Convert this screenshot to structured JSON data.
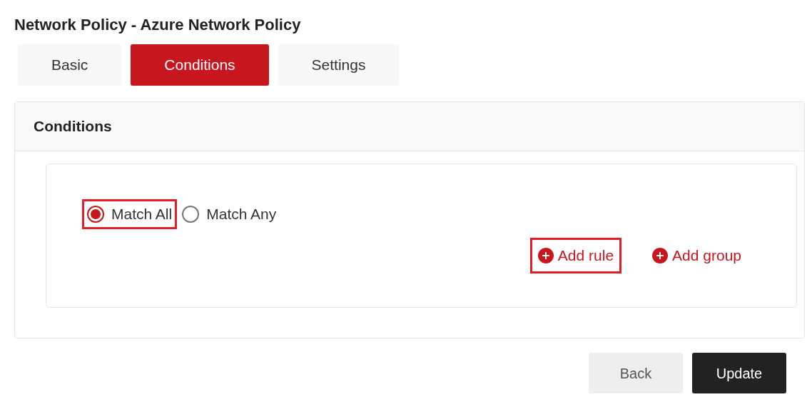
{
  "title": "Network Policy - Azure Network Policy",
  "tabs": [
    {
      "label": "Basic",
      "selected": false
    },
    {
      "label": "Conditions",
      "selected": true
    },
    {
      "label": "Settings",
      "selected": false
    }
  ],
  "panel": {
    "heading": "Conditions",
    "match_options": [
      {
        "label": "Match All",
        "selected": true,
        "highlighted": true
      },
      {
        "label": "Match Any",
        "selected": false,
        "highlighted": false
      }
    ],
    "actions": [
      {
        "label": "Add rule",
        "highlighted": true
      },
      {
        "label": "Add group",
        "highlighted": false
      }
    ]
  },
  "buttons": [
    {
      "label": "Back",
      "kind": "secondary"
    },
    {
      "label": "Update",
      "kind": "primary"
    }
  ]
}
